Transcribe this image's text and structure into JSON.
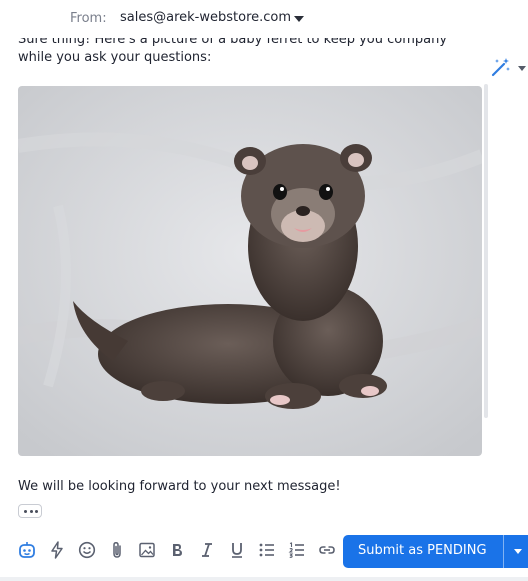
{
  "from": {
    "label": "From:",
    "email": "sales@arek-webstore.com"
  },
  "message": {
    "body": "Sure thing! Here's a picture of a baby ferret to keep you company while you ask your questions:",
    "closing": "We will be looking forward to your next message!"
  },
  "image": {
    "subject": "baby ferret on grey blanket"
  },
  "toolbar": {
    "icons": [
      "ai-assistant-icon",
      "lightning-icon",
      "emoji-icon",
      "paperclip-icon",
      "image-icon",
      "bold-icon",
      "italic-icon",
      "underline-icon",
      "bullet-list-icon",
      "numbered-list-icon",
      "link-icon"
    ],
    "submit_label": "Submit as PENDING"
  },
  "colors": {
    "accent": "#1a73e8",
    "ai_icon": "#2f7de1"
  }
}
